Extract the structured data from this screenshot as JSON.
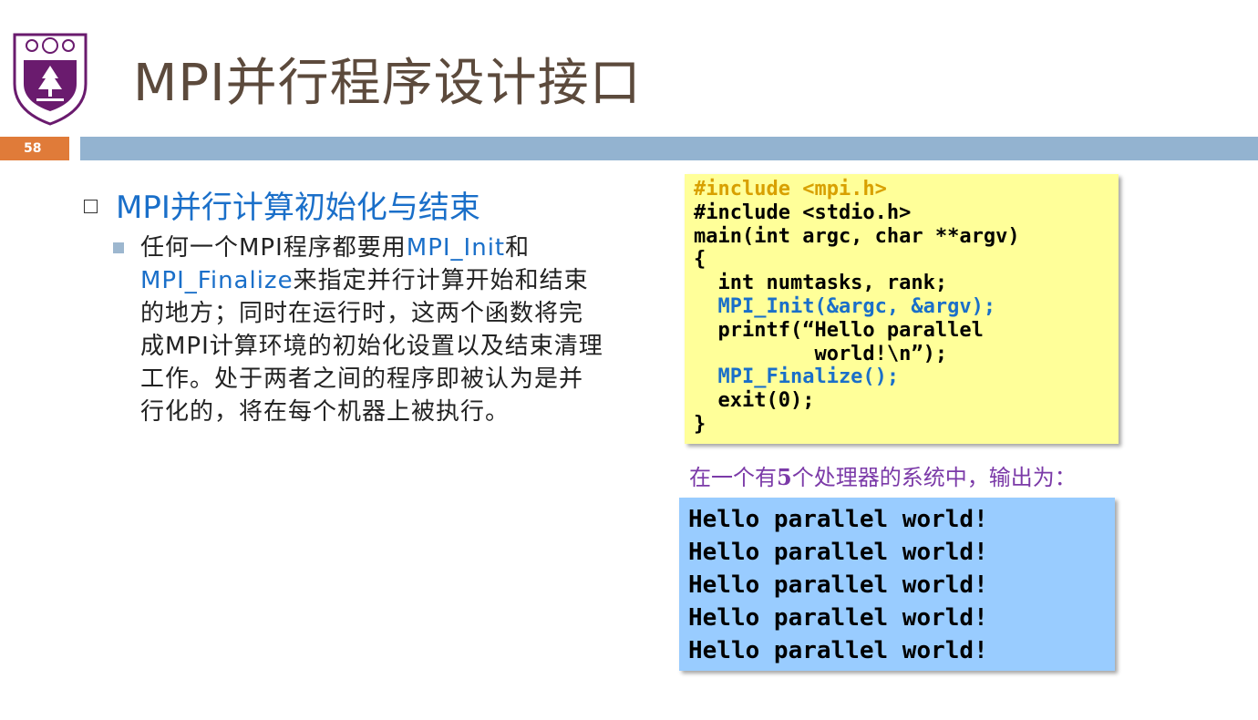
{
  "page": {
    "title": "MPI并行程序设计接口",
    "page_number": "58"
  },
  "bullet1": {
    "text": "MPI并行计算初始化与结束"
  },
  "bullet2": {
    "t1": "任何一个MPI程序都要用",
    "k1": "MPI_Init",
    "t2": "和",
    "k2": "MPI_Finalize",
    "t3": "来指定并行计算开始和结束的地方；同时在运行时，这两个函数将完成MPI计算环境的初始化设置以及结束清理工作。处于两者之间的程序即被认为是并行化的，将在每个机器上被执行。"
  },
  "code": {
    "l1": "#include <mpi.h>",
    "l2": "#include <stdio.h>",
    "l3": "main(int argc, char **argv)",
    "l4": "{",
    "l5": "  int numtasks, rank;",
    "l6": "  MPI_Init(&argc, &argv);",
    "l7": "  printf(“Hello parallel",
    "l8": "          world!\\n”);",
    "l9": "  MPI_Finalize();",
    "l10": "  exit(0);",
    "l11": "}"
  },
  "caption": {
    "before": "在一个有",
    "num": "5",
    "after": "个处理器的系统中，输出为："
  },
  "output": {
    "lines": [
      "Hello parallel world!",
      "Hello parallel world!",
      "Hello parallel world!",
      "Hello parallel world!",
      "Hello parallel world!"
    ]
  },
  "colors": {
    "accent_orange": "#e07b39",
    "header_bar": "#93b3d0",
    "code_bg": "#ffff99",
    "output_bg": "#99ccff",
    "keyword_blue": "#1a6fc9",
    "caption_purple": "#7b3aa8",
    "logo_purple": "#6a1b6e"
  },
  "icons": {
    "logo": "nanjing-university-logo-icon"
  }
}
